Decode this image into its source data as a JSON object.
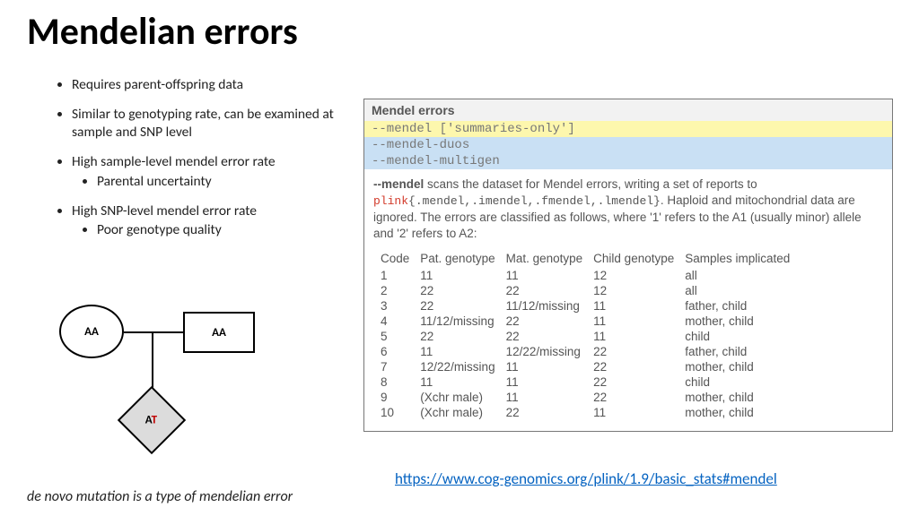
{
  "title": "Mendelian errors",
  "bullets": {
    "b1": "Requires parent-offspring data",
    "b2": "Similar to genotyping rate, can be examined at sample and SNP level",
    "b3": "High sample-level mendel error rate",
    "b3a": "Parental uncertainty",
    "b4": "High SNP-level mendel error rate",
    "b4a": "Poor genotype quality"
  },
  "pedigree": {
    "mother": "AA",
    "father": "AA",
    "child_a": "A",
    "child_t": "T"
  },
  "footnote": "de novo mutation is a type of mendelian error",
  "doc": {
    "header": "Mendel errors",
    "code1": "--mendel ['summaries-only']",
    "code2": "--mendel-duos",
    "code3": "--mendel-multigen",
    "desc_flag": "--mendel",
    "desc_1": " scans the dataset for Mendel errors, writing a set of reports to ",
    "desc_plink": "plink",
    "desc_ext": "{.mendel,.imendel,.fmendel,.lmendel}",
    "desc_2": ". Haploid and mitochondrial data are ignored. The errors are classified as follows, where '1' refers to the A1 (usually minor) allele and '2' refers to A2:",
    "table": {
      "h1": "Code",
      "h2": "Pat. genotype",
      "h3": "Mat. genotype",
      "h4": "Child genotype",
      "h5": "Samples implicated",
      "rows": [
        {
          "c": "1",
          "p": "11",
          "m": "11",
          "ch": "12",
          "s": "all"
        },
        {
          "c": "2",
          "p": "22",
          "m": "22",
          "ch": "12",
          "s": "all"
        },
        {
          "c": "3",
          "p": "22",
          "m": "11/12/missing",
          "ch": "11",
          "s": "father, child"
        },
        {
          "c": "4",
          "p": "11/12/missing",
          "m": "22",
          "ch": "11",
          "s": "mother, child"
        },
        {
          "c": "5",
          "p": "22",
          "m": "22",
          "ch": "11",
          "s": "child"
        },
        {
          "c": "6",
          "p": "11",
          "m": "12/22/missing",
          "ch": "22",
          "s": "father, child"
        },
        {
          "c": "7",
          "p": "12/22/missing",
          "m": "11",
          "ch": "22",
          "s": "mother, child"
        },
        {
          "c": "8",
          "p": "11",
          "m": "11",
          "ch": "22",
          "s": "child"
        },
        {
          "c": "9",
          "p": "(Xchr male)",
          "m": "11",
          "ch": "22",
          "s": "mother, child"
        },
        {
          "c": "10",
          "p": "(Xchr male)",
          "m": "22",
          "ch": "11",
          "s": "mother, child"
        }
      ]
    }
  },
  "link": "https://www.cog-genomics.org/plink/1.9/basic_stats#mendel"
}
